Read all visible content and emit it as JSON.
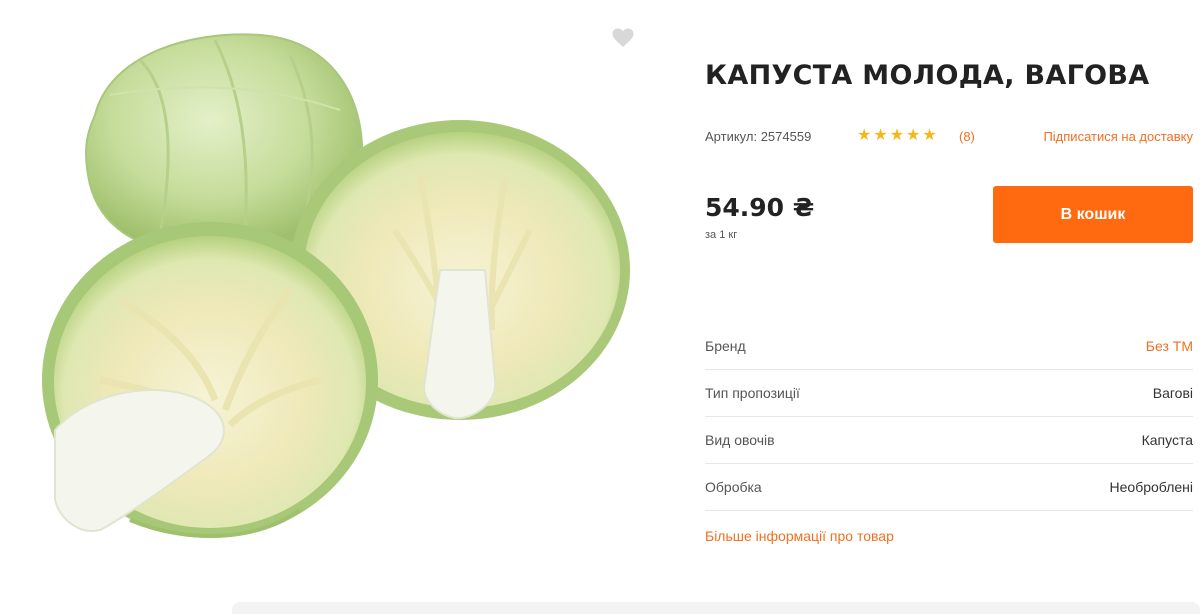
{
  "product": {
    "title": "КАПУСТА МОЛОДА, ВАГОВА",
    "image_alt": "cabbage-photo",
    "sku_label": "Артикул: 2574559",
    "rating": 5,
    "stars": [
      "★",
      "★",
      "★",
      "★",
      "★"
    ],
    "reviews_count": "(8)",
    "subscribe_label": "Підписатися на доставку",
    "price": "54.90 ₴",
    "price_unit": "за 1 кг",
    "cart_button": "В кошик",
    "more_info_link": "Більше інформації про товар"
  },
  "specs": [
    {
      "label": "Бренд",
      "value": "Без ТМ"
    },
    {
      "label": "Тип пропозиції",
      "value": "Вагові"
    },
    {
      "label": "Вид овочів",
      "value": "Капуста"
    },
    {
      "label": "Обробка",
      "value": "Необроблені"
    }
  ],
  "colors": {
    "accent": "#ff6a10",
    "link": "#f36f21",
    "star": "#f5b81c"
  },
  "icons": {
    "favorite": "heart-icon",
    "rating": "star-icon"
  }
}
